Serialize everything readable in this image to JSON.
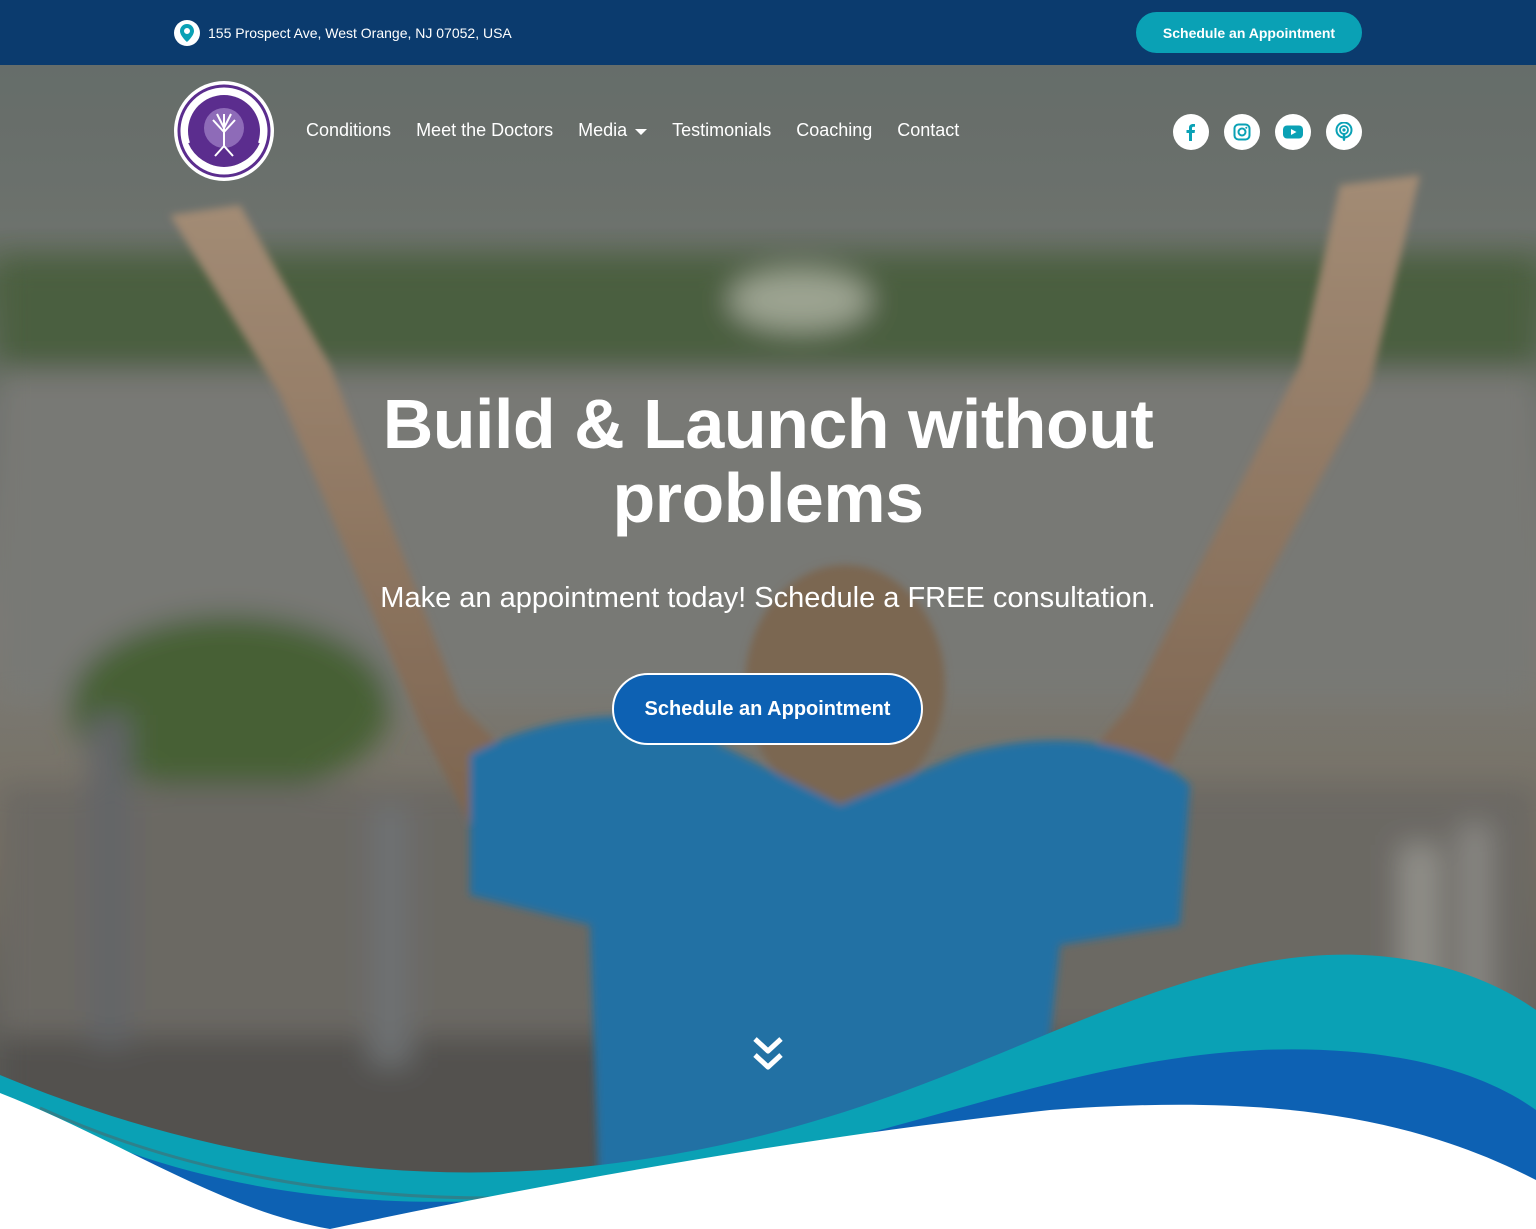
{
  "topbar": {
    "address": "155 Prospect Ave, West Orange, NJ 07052, USA",
    "cta_label": "Schedule an Appointment"
  },
  "nav": {
    "logo_alt": "Montclair Upper Cervical Chiropractic",
    "items": [
      {
        "label": "Conditions"
      },
      {
        "label": "Meet the Doctors"
      },
      {
        "label": "Media",
        "has_dropdown": true
      },
      {
        "label": "Testimonials"
      },
      {
        "label": "Coaching"
      },
      {
        "label": "Contact"
      }
    ],
    "socials": [
      "facebook-icon",
      "instagram-icon",
      "youtube-icon",
      "podcast-icon"
    ]
  },
  "hero": {
    "headline_line1": "Build & Launch without",
    "headline_line2": "problems",
    "subheadline": "Make an appointment today! Schedule a FREE consultation.",
    "cta_label": "Schedule an Appointment"
  },
  "colors": {
    "topbar_bg": "#0b3b6e",
    "teal": "#0aa1b5",
    "blue": "#0d61b3",
    "social_icon": "#0aa1b5",
    "logo_purple": "#5b2d8e"
  }
}
